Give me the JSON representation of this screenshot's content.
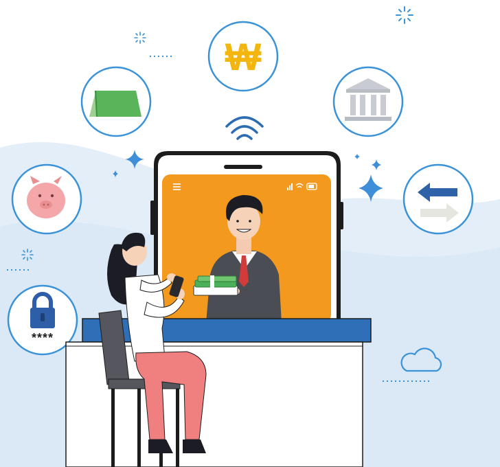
{
  "illustration": {
    "card_label": "",
    "pin_mask": "****",
    "currency_symbol": "₩"
  },
  "icons": [
    "won-coin-icon",
    "green-card-icon",
    "bank-building-icon",
    "piggy-bank-icon",
    "transfer-arrows-icon",
    "padlock-icon",
    "wifi-icon",
    "cloud-icon",
    "sparkle-icon"
  ],
  "colors": {
    "accent_orange": "#f39a1e",
    "accent_blue": "#2b6cb3",
    "counter_blue": "#2f6fb8",
    "circle_border": "#3a92d8",
    "background_wave": "#dde9f5",
    "skirt_pink": "#f07f7f",
    "suit_gray": "#4b4d55",
    "money_green": "#4cb05a"
  }
}
